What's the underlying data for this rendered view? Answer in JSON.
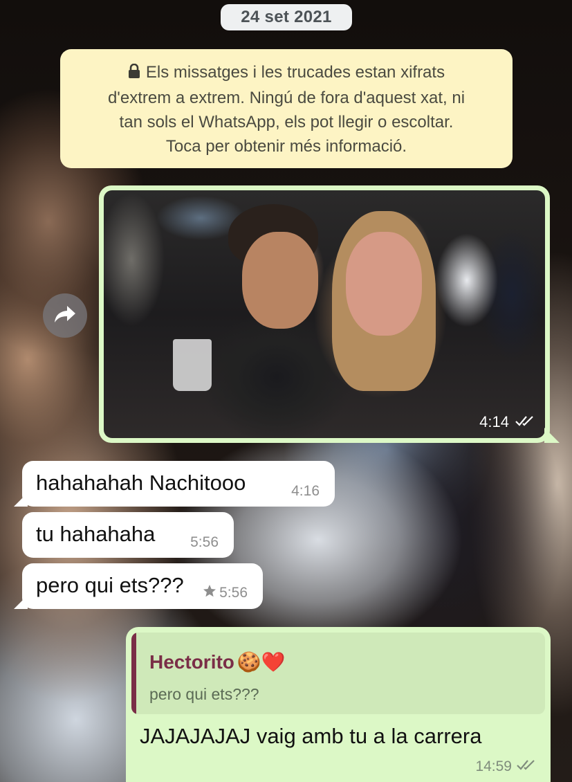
{
  "chat": {
    "date_divider": "24 set 2021",
    "encryption_notice": {
      "line1": "Els missatges i les trucades estan xifrats",
      "line2": "d'extrem a extrem. Ningú de fora d'aquest xat, ni",
      "line3": "tan sols el WhatsApp, els pot llegir o escoltar.",
      "line4": "Toca per obtenir més informació.",
      "icon": "lock-icon"
    },
    "messages": [
      {
        "direction": "out",
        "type": "image",
        "time": "4:14",
        "status": "read",
        "forward_icon": "forward-icon"
      },
      {
        "direction": "in",
        "text": "hahahahah Nachitooo",
        "time": "4:16"
      },
      {
        "direction": "in",
        "text": "tu hahahaha",
        "time": "5:56"
      },
      {
        "direction": "in",
        "text": "pero qui ets???",
        "time": "5:56",
        "starred": true,
        "star_icon": "star-icon"
      },
      {
        "direction": "out",
        "reply_to": {
          "author": "Hectorito",
          "author_emoji": "🍪❤️",
          "text": "pero qui ets???"
        },
        "text": "JAJAJAJAJ vaig amb tu a la carrera",
        "time": "14:59",
        "status": "read"
      }
    ]
  },
  "colors": {
    "outgoing_bubble": "#dcf8c6",
    "incoming_bubble": "#ffffff",
    "notice_bg": "#fdf4c4",
    "quote_author": "#7a2e47",
    "date_pill": "#eef0f1"
  }
}
